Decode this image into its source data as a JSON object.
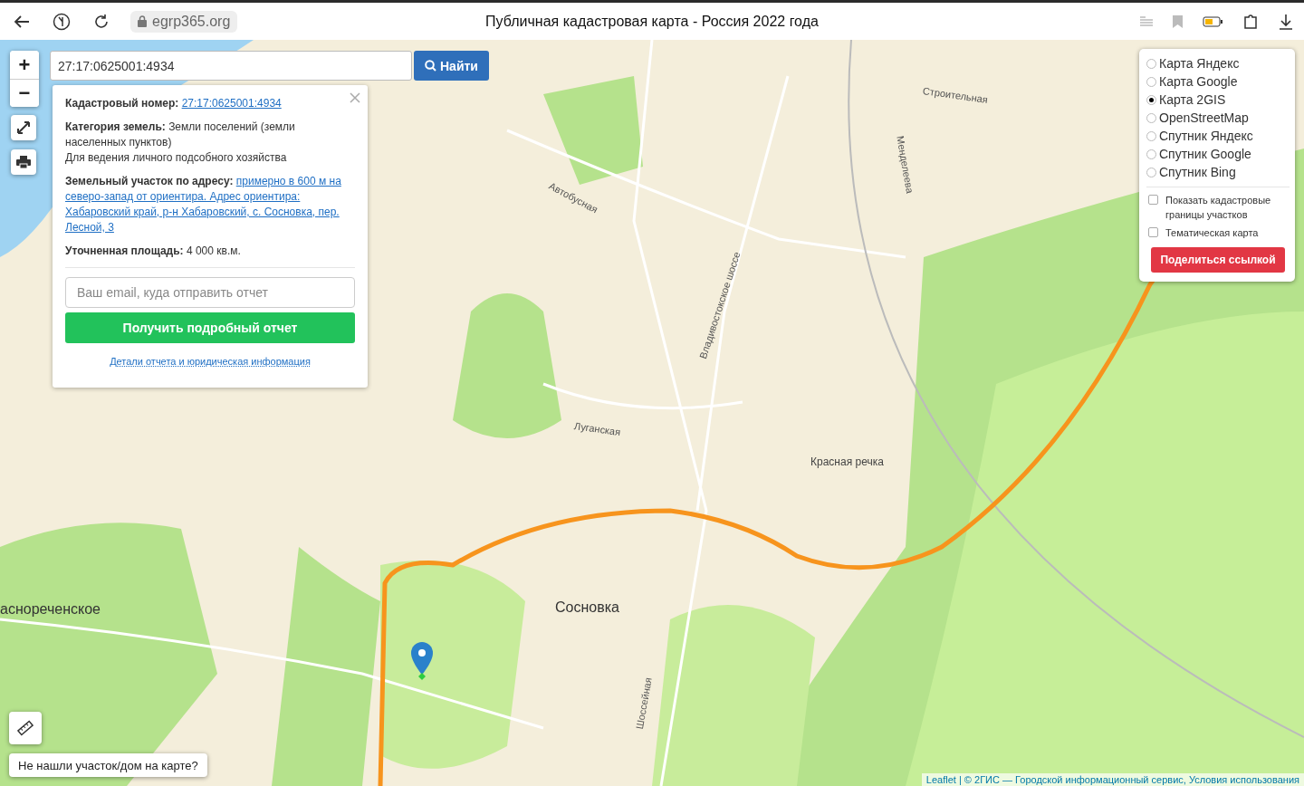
{
  "browser": {
    "url": "egrp365.org",
    "title": "Публичная кадастровая карта - Россия 2022 года"
  },
  "zoom_controls": [
    "+",
    "−"
  ],
  "search": {
    "value": "27:17:0625001:4934",
    "button": "Найти"
  },
  "popup": {
    "fields": [
      {
        "kind": "link",
        "label": "Кадастровый номер:",
        "value": "27:17:0625001:4934"
      },
      {
        "kind": "text",
        "label": "Категория земель:",
        "value": "Земли поселений (земли населенных пунктов)",
        "note": "Для ведения личного подсобного хозяйства"
      },
      {
        "kind": "link",
        "label": "Земельный участок по адресу:",
        "value": "примерно в 600 м на северо-запад от ориентира. Адрес ориентира: Хабаровский край, р-н Хабаровский, с. Сосновка, пер. Лесной, 3"
      },
      {
        "kind": "text",
        "label": "Уточненная площадь:",
        "value": "4 000 кв.м."
      }
    ],
    "email_placeholder": "Ваш email, куда отправить отчет",
    "report_button": "Получить подробный отчет",
    "details_link": "Детали отчета и юридическая информация"
  },
  "layers": {
    "options": [
      {
        "label": "Карта Яндекс",
        "selected": false
      },
      {
        "label": "Карта Google",
        "selected": false
      },
      {
        "label": "Карта 2GIS",
        "selected": true
      },
      {
        "label": "OpenStreetMap",
        "selected": false
      },
      {
        "label": "Спутник Яндекс",
        "selected": false
      },
      {
        "label": "Спутник Google",
        "selected": false
      },
      {
        "label": "Спутник Bing",
        "selected": false
      }
    ],
    "checkboxes": [
      {
        "label": "Показать кадастровые границы участков",
        "checked": false
      },
      {
        "label": "Тематическая карта",
        "checked": false
      }
    ],
    "share_button": "Поделиться ссылкой"
  },
  "map_labels": [
    {
      "text": "Сосновка",
      "kind": "town"
    },
    {
      "text": "аснореченское",
      "kind": "town"
    },
    {
      "text": "Красная речка",
      "kind": "place"
    },
    {
      "text": "Луганская",
      "kind": "street"
    },
    {
      "text": "Автобусная",
      "kind": "street"
    },
    {
      "text": "Владивостокское шоссе",
      "kind": "street"
    },
    {
      "text": "Менделеева",
      "kind": "street"
    },
    {
      "text": "Строительная",
      "kind": "street"
    },
    {
      "text": "Шоссейная",
      "kind": "street"
    }
  ],
  "not_found_button": "Не нашли участок/дом на карте?",
  "attribution": "Leaflet | © 2ГИС — Городской информационный сервис, Условия использования"
}
